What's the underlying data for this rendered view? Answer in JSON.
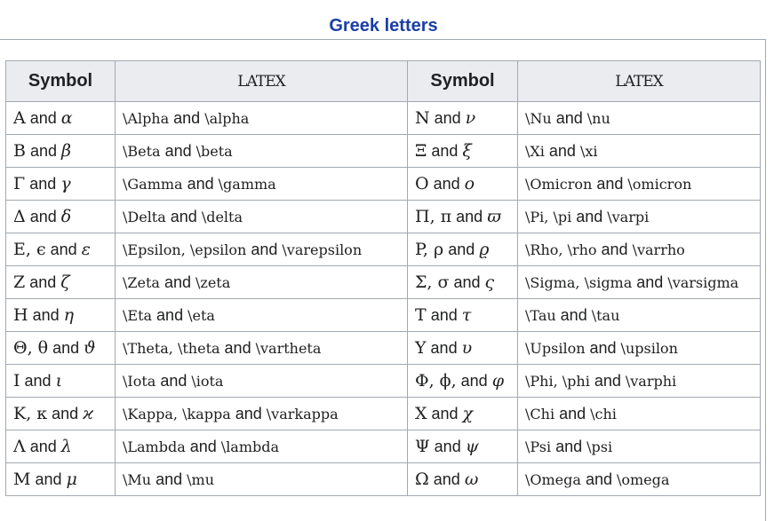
{
  "caption": "Greek letters",
  "headers": {
    "symbol": "Symbol",
    "latex": "LATEX"
  },
  "rows": [
    {
      "s1": [
        "A",
        " and ",
        "α"
      ],
      "l1": [
        "\\Alpha",
        " and ",
        "\\alpha"
      ],
      "s2": [
        "N",
        " and ",
        "ν"
      ],
      "l2": [
        "\\Nu",
        " and ",
        "\\nu"
      ]
    },
    {
      "s1": [
        "B",
        " and ",
        "β"
      ],
      "l1": [
        "\\Beta",
        " and ",
        "\\beta"
      ],
      "s2": [
        "Ξ",
        " and ",
        "ξ"
      ],
      "l2": [
        "\\Xi",
        " and ",
        "\\xi"
      ]
    },
    {
      "s1": [
        "Γ",
        " and ",
        "γ"
      ],
      "l1": [
        "\\Gamma",
        " and ",
        "\\gamma"
      ],
      "s2": [
        "O",
        " and ",
        "o"
      ],
      "l2": [
        "\\Omicron",
        " and ",
        "\\omicron"
      ]
    },
    {
      "s1": [
        "Δ",
        " and ",
        "δ"
      ],
      "l1": [
        "\\Delta",
        " and ",
        "\\delta"
      ],
      "s2": [
        "Π, π",
        " and ",
        "ϖ"
      ],
      "l2": [
        "\\Pi, \\pi",
        " and ",
        "\\varpi"
      ]
    },
    {
      "s1": [
        "E, ϵ",
        " and ",
        "ε"
      ],
      "l1": [
        "\\Epsilon, \\epsilon",
        " and ",
        "\\varepsilon"
      ],
      "s2": [
        "P, ρ",
        " and ",
        "ϱ"
      ],
      "l2": [
        "\\Rho, \\rho",
        " and ",
        "\\varrho"
      ]
    },
    {
      "s1": [
        "Z",
        " and ",
        "ζ"
      ],
      "l1": [
        "\\Zeta",
        " and ",
        "\\zeta"
      ],
      "s2": [
        "Σ, σ",
        " and ",
        "ς"
      ],
      "l2": [
        "\\Sigma, \\sigma",
        " and ",
        "\\varsigma"
      ]
    },
    {
      "s1": [
        "H",
        " and ",
        "η"
      ],
      "l1": [
        "\\Eta",
        " and ",
        "\\eta"
      ],
      "s2": [
        "T",
        " and ",
        "τ"
      ],
      "l2": [
        "\\Tau",
        " and ",
        "\\tau"
      ]
    },
    {
      "s1": [
        "Θ, θ",
        " and ",
        "ϑ"
      ],
      "l1": [
        "\\Theta, \\theta",
        " and ",
        "\\vartheta"
      ],
      "s2": [
        "Υ",
        " and ",
        "υ"
      ],
      "l2": [
        "\\Upsilon",
        " and ",
        "\\upsilon"
      ]
    },
    {
      "s1": [
        "I",
        " and ",
        "ι"
      ],
      "l1": [
        "\\Iota",
        " and ",
        "\\iota"
      ],
      "s2": [
        "Φ, ϕ,",
        " and ",
        "φ"
      ],
      "l2": [
        "\\Phi, \\phi",
        " and ",
        "\\varphi"
      ]
    },
    {
      "s1": [
        "K, κ",
        " and ",
        "ϰ"
      ],
      "l1": [
        "\\Kappa, \\kappa",
        " and ",
        "\\varkappa"
      ],
      "s2": [
        "X",
        " and ",
        "χ"
      ],
      "l2": [
        "\\Chi",
        " and ",
        "\\chi"
      ]
    },
    {
      "s1": [
        "Λ",
        " and ",
        "λ"
      ],
      "l1": [
        "\\Lambda",
        " and ",
        "\\lambda"
      ],
      "s2": [
        "Ψ",
        " and ",
        "ψ"
      ],
      "l2": [
        "\\Psi",
        " and ",
        "\\psi"
      ]
    },
    {
      "s1": [
        "M",
        " and ",
        "μ"
      ],
      "l1": [
        "\\Mu",
        " and ",
        "\\mu"
      ],
      "s2": [
        "Ω",
        " and ",
        "ω"
      ],
      "l2": [
        "\\Omega",
        " and ",
        "\\omega"
      ]
    }
  ]
}
